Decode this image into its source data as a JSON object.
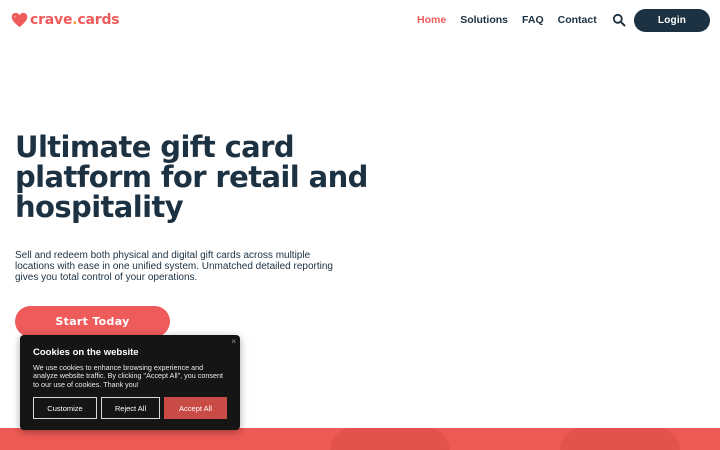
{
  "brand": {
    "name_part1": "crave",
    "dot": ".",
    "name_part2": "cards",
    "heart_color": "#ef5b5b",
    "dot_color": "#f2a33a"
  },
  "nav": {
    "items": [
      {
        "label": "Home",
        "active": true
      },
      {
        "label": "Solutions",
        "active": false
      },
      {
        "label": "FAQ",
        "active": false
      },
      {
        "label": "Contact",
        "active": false
      }
    ],
    "search_icon": "search-icon",
    "login_label": "Login"
  },
  "hero": {
    "title": "Ultimate gift card platform for retail and hospitality",
    "description": "Sell and redeem both physical and digital gift cards across multiple locations with ease in one unified system. Unmatched detailed reporting gives you total control of your operations.",
    "cta_label": "Start Today"
  },
  "cookie": {
    "close_glyph": "×",
    "title": "Cookies on the website",
    "body": "We use cookies to enhance browsing experience and analyze website traffic. By clicking \"Accept All\", you consent to our use of cookies. Thank you!",
    "customize_label": "Customize",
    "reject_label": "Reject All",
    "accept_label": "Accept All"
  },
  "colors": {
    "accent": "#ef5b5b",
    "navy": "#1c3142",
    "cookie_bg": "#151515"
  }
}
